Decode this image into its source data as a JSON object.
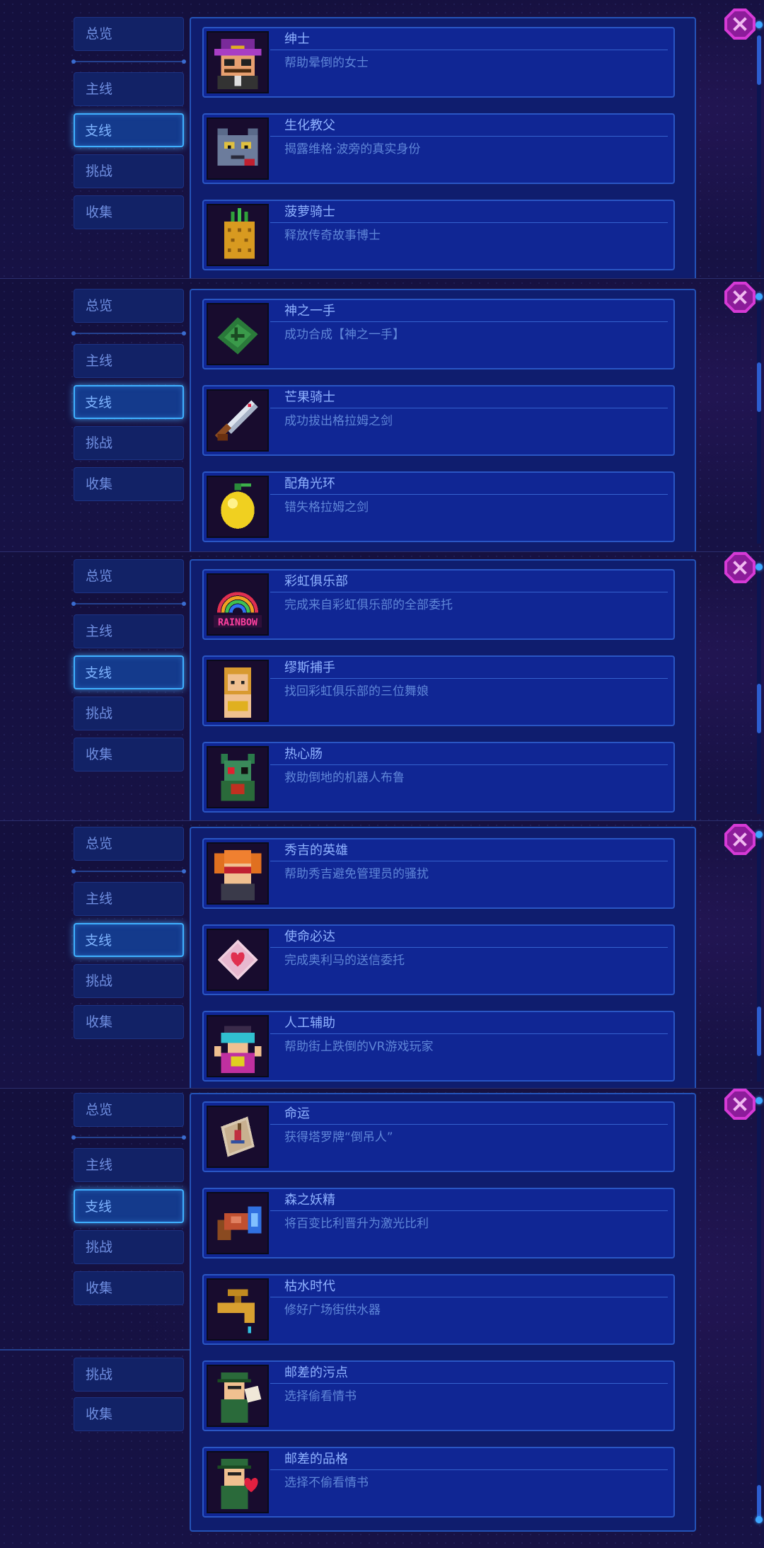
{
  "tabs": {
    "overview": "总览",
    "main": "主线",
    "side": "支线",
    "challenge": "挑战",
    "collection": "收集"
  },
  "panels": [
    {
      "items": [
        {
          "title": "绅士",
          "desc": "帮助晕倒的女士",
          "icon": "gentleman-icon"
        },
        {
          "title": "生化教父",
          "desc": "揭露维格·波旁的真实身份",
          "icon": "cat-godfather-icon"
        },
        {
          "title": "菠萝骑士",
          "desc": "释放传奇故事博士",
          "icon": "pineapple-icon"
        }
      ]
    },
    {
      "items": [
        {
          "title": "神之一手",
          "desc": "成功合成【神之一手】",
          "icon": "green-glove-icon"
        },
        {
          "title": "芒果骑士",
          "desc": "成功拔出格拉姆之剑",
          "icon": "sword-icon"
        },
        {
          "title": "配角光环",
          "desc": "错失格拉姆之剑",
          "icon": "lemon-icon"
        }
      ]
    },
    {
      "items": [
        {
          "title": "彩虹俱乐部",
          "desc": "完成来自彩虹俱乐部的全部委托",
          "icon": "rainbow-sign-icon",
          "sign": "RAINBOW"
        },
        {
          "title": "缪斯捕手",
          "desc": "找回彩虹俱乐部的三位舞娘",
          "icon": "dancer-icon"
        },
        {
          "title": "热心肠",
          "desc": "救助倒地的机器人布鲁",
          "icon": "robot-icon"
        }
      ]
    },
    {
      "items": [
        {
          "title": "秀吉的英雄",
          "desc": "帮助秀吉避免管理员的骚扰",
          "icon": "girl-goggles-icon"
        },
        {
          "title": "使命必达",
          "desc": "完成奥利马的送信委托",
          "icon": "love-letter-icon"
        },
        {
          "title": "人工辅助",
          "desc": "帮助街上跌倒的VR游戏玩家",
          "icon": "vr-player-icon"
        }
      ]
    },
    {
      "items": [
        {
          "title": "命运",
          "desc": "获得塔罗牌“倒吊人”",
          "icon": "tarot-card-icon"
        },
        {
          "title": "森之妖精",
          "desc": "将百变比利晋升为激光比利",
          "icon": "laser-gun-icon"
        },
        {
          "title": "枯水时代",
          "desc": "修好广场街供水器",
          "icon": "faucet-icon"
        },
        {
          "title": "邮差的污点",
          "desc": "选择偷看情书",
          "icon": "postman-letter-icon"
        },
        {
          "title": "邮差的品格",
          "desc": "选择不偷看情书",
          "icon": "postman-heart-icon"
        }
      ]
    }
  ],
  "colors": {
    "accent": "#3fb0ff",
    "card_bg": "#102694",
    "close": "#d63ad6"
  }
}
